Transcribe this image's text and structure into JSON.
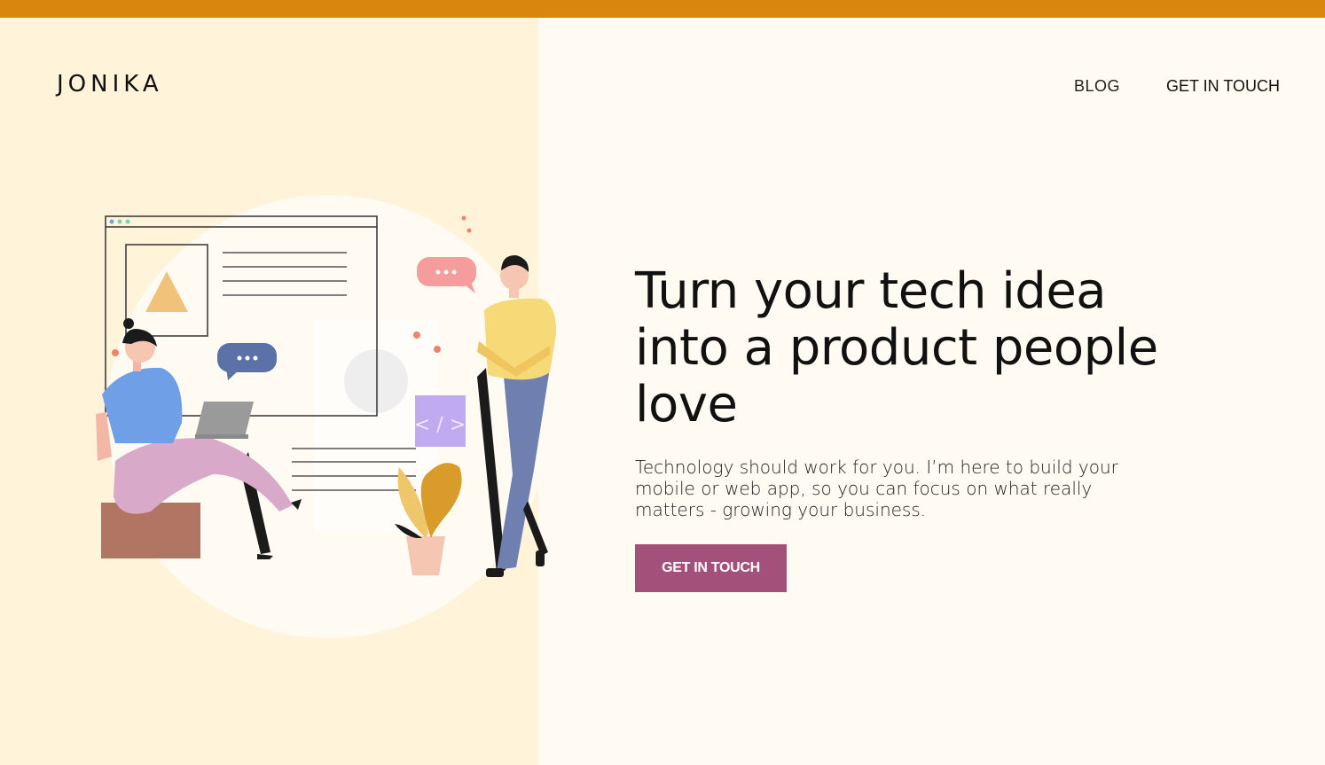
{
  "brand": {
    "logo": "JONIKA"
  },
  "nav": {
    "blog": "BLOG",
    "contact": "GET IN TOUCH"
  },
  "hero": {
    "headline": "Turn your tech idea into a product people love",
    "subtext": "Technology should work for you. I’m here to build your mobile or web app, so you can focus on what really matters - growing your business.",
    "cta": "GET IN TOUCH",
    "code_badge": "< / >"
  },
  "colors": {
    "top_bar": "#d9860e",
    "left_panel": "#fff3d9",
    "page_bg": "#fffaf2",
    "cta_bg": "#a3507b"
  },
  "illustration": {
    "icons": [
      "browser-window-icon",
      "chat-bubble-icon",
      "code-icon",
      "laptop-icon",
      "plant-icon"
    ]
  }
}
